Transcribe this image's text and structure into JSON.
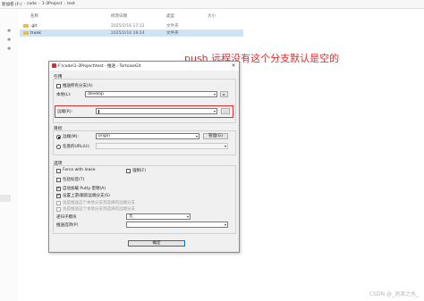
{
  "explorer": {
    "breadcrumb": [
      "新加卷 (F:)",
      "code",
      "1-3Project",
      "test"
    ],
    "columns": [
      "名称",
      "修改日期",
      "类型",
      "大小"
    ],
    "files": [
      {
        "name": ".git",
        "modified": "2025/2/16 17:12",
        "type": "文件夹",
        "selected": false
      },
      {
        "name": "trunk",
        "modified": "2025/2/16 18:24",
        "type": "文件夹",
        "selected": true
      }
    ],
    "folder_color": "#e8c04a"
  },
  "annotation": {
    "text": "push 远程没有这个分支默认是空的",
    "color": "#e52b2b"
  },
  "dialog": {
    "title": "F:\\code\\1-3Project\\test - 推送 - TortoiseGit",
    "close_glyph": "×",
    "ref_section": {
      "label": "引用",
      "push_all_branches": {
        "label": "推送所有分支(A)",
        "checked": false
      },
      "local_label": "本地(L):",
      "local_value": "develop",
      "remote_label": "远端(R):",
      "remote_value": "",
      "more_button": "..."
    },
    "target_section": {
      "label": "目标",
      "remote_radio": {
        "label": "远端(M):",
        "checked": true
      },
      "remote_value": "origin",
      "manage_button": "管理(G)",
      "url_radio": {
        "label": "任意的URL(U):",
        "checked": false
      }
    },
    "options_section": {
      "label": "选项",
      "force_with_lease": {
        "label": "Force with lease",
        "checked": false
      },
      "force": {
        "label": "强制(F)",
        "checked": false
      },
      "include_tags": {
        "label": "包括标签(T)",
        "checked": false
      },
      "autoload_putty": {
        "label": "自动加载 Putty 密钥(A)",
        "checked": true
      },
      "set_upstream": {
        "label": "设置上游/跟踪远端分支(S)",
        "checked": true
      },
      "always_push_selected": {
        "label": "总是推送这个本地分支到选择的远端分支",
        "checked": false
      },
      "always_push_remote": {
        "label": "总是推送这个本地分支到选择的远端分支",
        "checked": false
      },
      "recurse_label": "递归子模块",
      "recurse_value": "无",
      "push_options_label": "推送选项(P)",
      "push_options_value": ""
    },
    "ok_button": "确定"
  },
  "watermark": "CSDN @_池浪之水_"
}
